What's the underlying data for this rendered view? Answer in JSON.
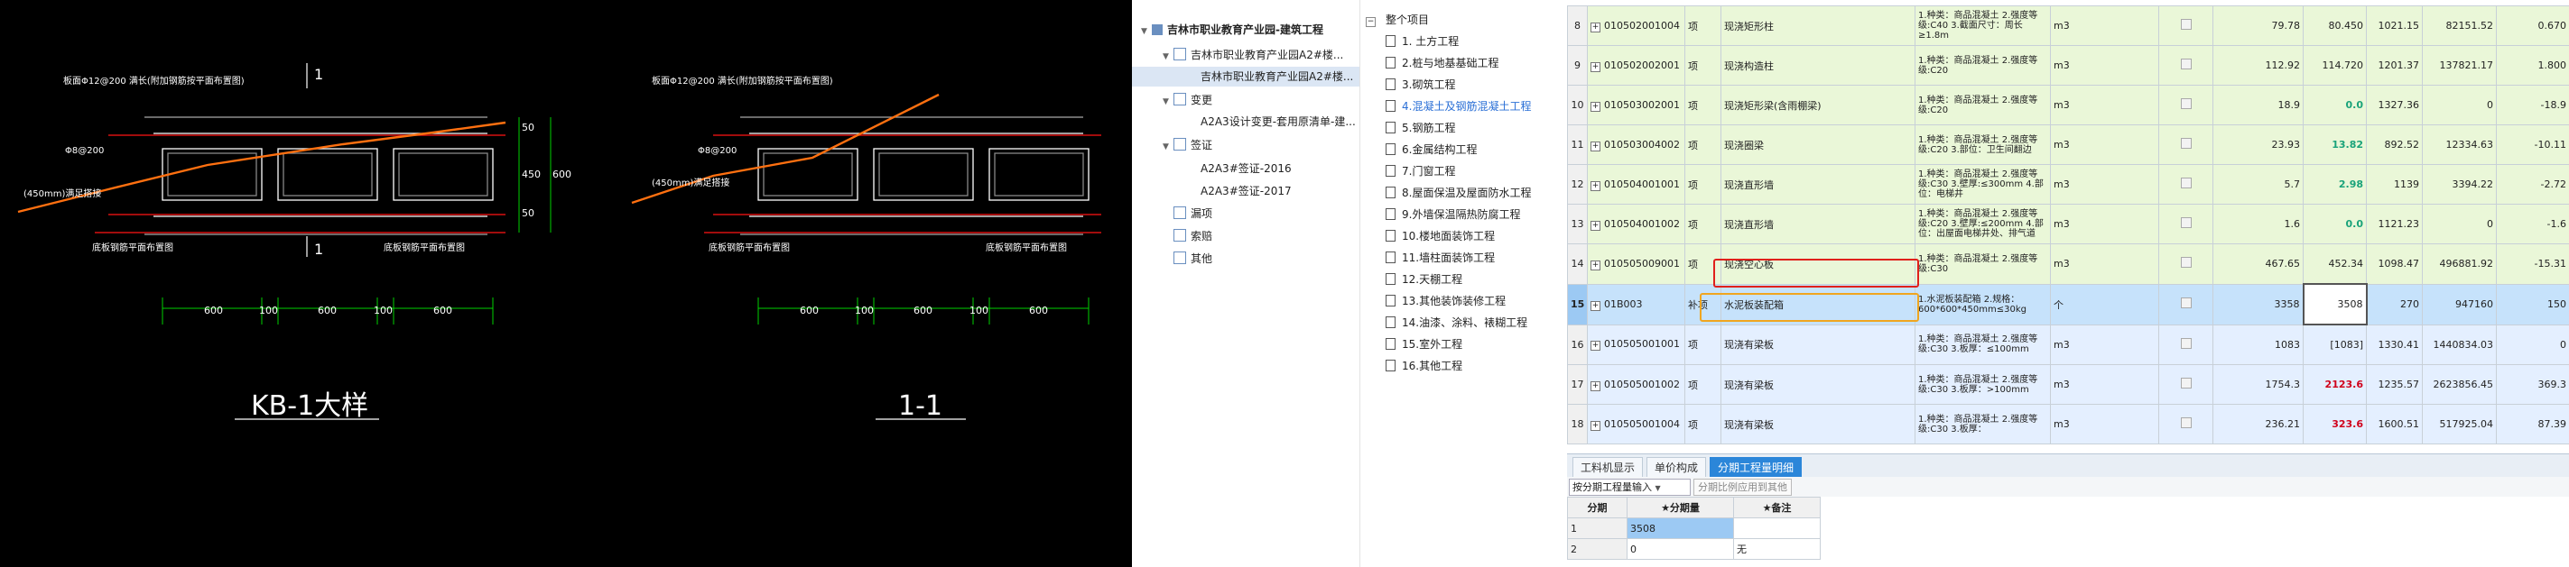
{
  "cad": {
    "left_title": "KB-1大样",
    "right_title": "1-1",
    "rebar_note_left": "板面Φ12@200 满长(附加钢筋按平面布置图)",
    "rebar_note_right": "板面Φ12@200 满长(附加钢筋按平面布置图)",
    "bar_label_left": "Φ8@200",
    "bar_label_right": "Φ8@200",
    "anchor_left": "(450mm)满足搭接",
    "anchor_right": "(450mm)满足搭接",
    "bottom_note_l1": "底板钢筋平面布置图",
    "bottom_note_l2": "底板钢筋平面布置图",
    "bottom_note_r1": "底板钢筋平面布置图",
    "bottom_note_r2": "底板钢筋平面布置图",
    "section_mark": "1",
    "dims": [
      "600",
      "100",
      "600",
      "100",
      "600"
    ],
    "dims_right": [
      "600",
      "100",
      "600",
      "100",
      "600"
    ],
    "vdims": [
      "50",
      "450",
      "600",
      "50"
    ]
  },
  "tree": {
    "root": "吉林市职业教育产业园-建筑工程",
    "items": [
      {
        "label": "吉林市职业教育产业园A2#楼..."
      },
      {
        "label": "吉林市职业教育产业园A2#楼..."
      },
      {
        "label": "变更"
      },
      {
        "label": "A2A3设计变更-套用原清单-建..."
      },
      {
        "label": "签证"
      },
      {
        "label": "A2A3#签证-2016"
      },
      {
        "label": "A2A3#签证-2017"
      },
      {
        "label": "漏项"
      },
      {
        "label": "索赔"
      },
      {
        "label": "其他"
      }
    ]
  },
  "sections": {
    "root": "整个项目",
    "items": [
      "1. 土方工程",
      "2.桩与地基基础工程",
      "3.砌筑工程",
      "4.混凝土及钢筋混凝土工程",
      "5.钢筋工程",
      "6.金属结构工程",
      "7.门窗工程",
      "8.屋面保温及屋面防水工程",
      "9.外墙保温隔热防腐工程",
      "10.楼地面装饰工程",
      "11.墙柱面装饰工程",
      "12.天棚工程",
      "13.其他装饰装修工程",
      "14.油漆、涂料、裱糊工程",
      "15.室外工程",
      "16.其他工程"
    ]
  },
  "grid": {
    "rows": [
      {
        "no": "8",
        "code": "010502001004",
        "type": "项",
        "name": "现浇矩形柱",
        "feat": "1.种类：商品混凝土 2.强度等级:C40 3.截面尺寸：周长≥1.8m",
        "unit": "m3",
        "q1": "79.78",
        "q2": "80.450",
        "price": "1021.15",
        "total": "82151.52",
        "diff": "0.670"
      },
      {
        "no": "9",
        "code": "010502002001",
        "type": "项",
        "name": "现浇构造柱",
        "feat": "1.种类：商品混凝土 2.强度等级:C20",
        "unit": "m3",
        "q1": "112.92",
        "q2": "114.720",
        "price": "1201.37",
        "total": "137821.17",
        "diff": "1.800"
      },
      {
        "no": "10",
        "code": "010503002001",
        "name": "现浇矩形梁(含雨棚梁)",
        "type": "项",
        "feat": "1.种类：商品混凝土 2.强度等级:C20",
        "unit": "m3",
        "q1": "18.9",
        "q2": "0.0",
        "price": "1327.36",
        "total": "0",
        "diff": "-18.9"
      },
      {
        "no": "11",
        "code": "010503004002",
        "type": "项",
        "name": "现浇圈梁",
        "feat": "1.种类：商品混凝土 2.强度等级:C20 3.部位：卫生间翻边",
        "unit": "m3",
        "q1": "23.93",
        "q2": "13.82",
        "price": "892.52",
        "total": "12334.63",
        "diff": "-10.11"
      },
      {
        "no": "12",
        "code": "010504001001",
        "type": "项",
        "name": "现浇直形墙",
        "feat": "1.种类：商品混凝土 2.强度等级:C30 3.壁厚:≤300mm 4.部位：电梯井",
        "unit": "m3",
        "q1": "5.7",
        "q2": "2.98",
        "price": "1139",
        "total": "3394.22",
        "diff": "-2.72"
      },
      {
        "no": "13",
        "code": "010504001002",
        "type": "项",
        "name": "现浇直形墙",
        "feat": "1.种类：商品混凝土 2.强度等级:C20 3.壁厚:≤200mm 4.部位：出屋面电梯井处、排气道",
        "unit": "m3",
        "q1": "1.6",
        "q2": "0.0",
        "price": "1121.23",
        "total": "0",
        "diff": "-1.6"
      },
      {
        "no": "14",
        "code": "010505009001",
        "type": "项",
        "name": "现浇空心板",
        "feat": "1.种类：商品混凝土 2.强度等级:C30",
        "unit": "m3",
        "q1": "467.65",
        "q2": "452.34",
        "price": "1098.47",
        "total": "496881.92",
        "diff": "-15.31"
      },
      {
        "no": "15",
        "code": "01B003",
        "type": "补项",
        "name": "水泥板装配箱",
        "feat": "1.水泥板装配箱 2.规格：600*600*450mm≤30kg",
        "unit": "个",
        "q1": "3358",
        "q2": "3508",
        "price": "270",
        "total": "947160",
        "diff": "150"
      },
      {
        "no": "16",
        "code": "010505001001",
        "type": "项",
        "name": "现浇有梁板",
        "feat": "1.种类：商品混凝土 2.强度等级:C30 3.板厚：≤100mm",
        "unit": "m3",
        "q1": "1083",
        "q2": "[1083]",
        "price": "1330.41",
        "total": "1440834.03",
        "diff": "0"
      },
      {
        "no": "17",
        "code": "010505001002",
        "type": "项",
        "name": "现浇有梁板",
        "feat": "1.种类：商品混凝土 2.强度等级:C30 3.板厚：>100mm",
        "unit": "m3",
        "q1": "1754.3",
        "q2": "2123.6",
        "price": "1235.57",
        "total": "2623856.45",
        "diff": "369.3"
      },
      {
        "no": "18",
        "code": "010505001004",
        "type": "项",
        "name": "现浇有梁板",
        "feat": "1.种类：商品混凝土 2.强度等级:C30 3.板厚：",
        "unit": "m3",
        "q1": "236.21",
        "q2": "323.6",
        "price": "1600.51",
        "total": "517925.04",
        "diff": "87.39"
      }
    ],
    "tabs": [
      "工料机显示",
      "单价构成",
      "分期工程量明细"
    ],
    "mode_select": "按分期工程量输入",
    "ratio_button": "分期比例应用到其他",
    "sub_headers": [
      "分期",
      "★分期量",
      "★备注"
    ],
    "sub_rows": [
      {
        "no": "1",
        "qty": "3508",
        "note": ""
      },
      {
        "no": "2",
        "qty": "0",
        "note": "无"
      }
    ]
  }
}
